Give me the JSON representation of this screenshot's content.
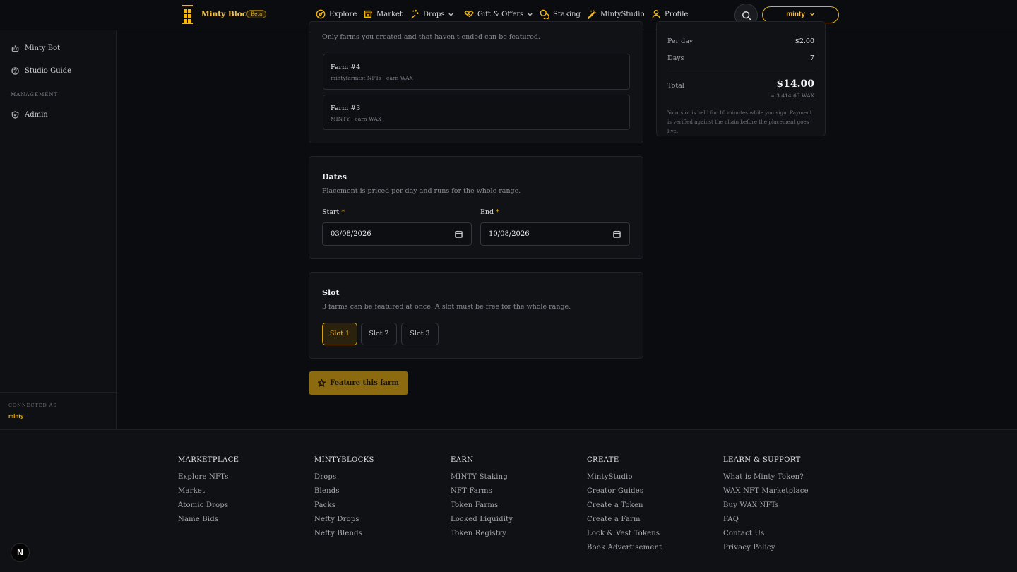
{
  "header": {
    "brand": "Minty Blocks",
    "beta": "Beta",
    "nav": [
      {
        "label": "Explore",
        "icon": "compass-icon"
      },
      {
        "label": "Market",
        "icon": "store-icon"
      },
      {
        "label": "Drops",
        "icon": "sparkle-icon"
      },
      {
        "label": "Gift & Offers",
        "icon": "handshake-icon"
      },
      {
        "label": "Staking",
        "icon": "coins-icon"
      },
      {
        "label": "MintyStudio",
        "icon": "wand-icon"
      },
      {
        "label": "Profile",
        "icon": "user-icon"
      }
    ],
    "user": "minty"
  },
  "sidebar": {
    "items": [
      {
        "label": "Minty Bot",
        "icon": "bot-icon"
      },
      {
        "label": "Studio Guide",
        "icon": "help-circle-icon"
      }
    ],
    "management_heading": "MANAGEMENT",
    "management_items": [
      {
        "label": "Admin",
        "icon": "shield-icon"
      }
    ],
    "connected_label": "CONNECTED AS",
    "connected_user": "minty"
  },
  "farm_card": {
    "description": "Only farms you created and that haven't ended can be featured.",
    "farms": [
      {
        "name": "Farm #4",
        "sub": "mintyfarmtst NFTs · earn WAX"
      },
      {
        "name": "Farm #3",
        "sub": "MINTY · earn WAX"
      }
    ]
  },
  "dates": {
    "title": "Dates",
    "description": "Placement is priced per day and runs for the whole range.",
    "start_label": "Start",
    "end_label": "End",
    "required_mark": "*",
    "start_value": "03/08/2026",
    "end_value": "10/08/2026"
  },
  "slot": {
    "title": "Slot",
    "description": "3 farms can be featured at once. A slot must be free for the whole range.",
    "slots": [
      "Slot 1",
      "Slot 2",
      "Slot 3"
    ],
    "selected": "Slot 1"
  },
  "cta": {
    "label": "Feature this farm"
  },
  "summary": {
    "per_day_label": "Per day",
    "per_day_value": "$2.00",
    "days_label": "Days",
    "days_value": "7",
    "total_label": "Total",
    "total_value": "$14.00",
    "total_wax": "≈ 3,414.63 WAX",
    "note": "Your slot is held for 10 minutes while you sign. Payment is verified against the chain before the placement goes live."
  },
  "footer": {
    "columns": [
      {
        "heading": "MARKETPLACE",
        "links": [
          "Explore NFTs",
          "Market",
          "Atomic Drops",
          "Name Bids"
        ]
      },
      {
        "heading": "MINTYBLOCKS",
        "links": [
          "Drops",
          "Blends",
          "Packs",
          "Nefty Drops",
          "Nefty Blends"
        ]
      },
      {
        "heading": "EARN",
        "links": [
          "MINTY Staking",
          "NFT Farms",
          "Token Farms",
          "Locked Liquidity",
          "Token Registry"
        ]
      },
      {
        "heading": "CREATE",
        "links": [
          "MintyStudio",
          "Creator Guides",
          "Create a Token",
          "Create a Farm",
          "Lock & Vest Tokens",
          "Book Advertisement"
        ]
      },
      {
        "heading": "LEARN & SUPPORT",
        "links": [
          "What is Minty Token?",
          "WAX NFT Marketplace",
          "Buy WAX NFTs",
          "FAQ",
          "Contact Us",
          "Privacy Policy"
        ]
      }
    ]
  },
  "badge": "N",
  "colors": {
    "accent": "#f2b80f",
    "background": "#0b0c0f",
    "card": "#111216"
  }
}
